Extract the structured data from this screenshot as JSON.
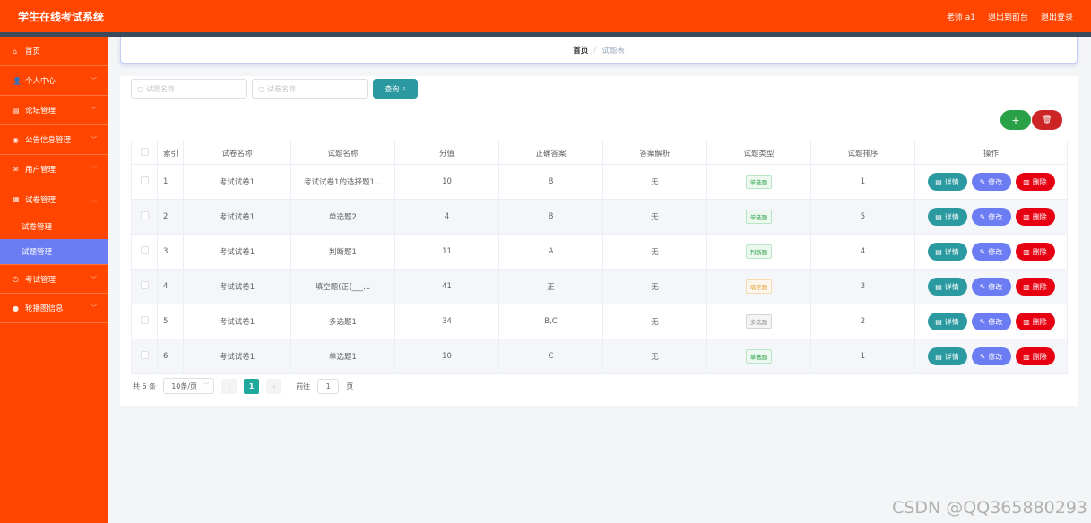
{
  "header": {
    "title": "学生在线考试系统",
    "links": [
      "老师 a1",
      "退出到前台",
      "退出登录"
    ]
  },
  "sidebar": {
    "items": [
      {
        "label": "首页",
        "icon": "home-icon"
      },
      {
        "label": "个人中心",
        "icon": "user-icon"
      },
      {
        "label": "论坛管理",
        "icon": "forum-icon"
      },
      {
        "label": "公告信息管理",
        "icon": "notice-icon"
      },
      {
        "label": "用户管理",
        "icon": "mail-icon"
      },
      {
        "label": "试卷管理",
        "icon": "paper-icon"
      },
      {
        "label": "考试管理",
        "icon": "exam-icon"
      },
      {
        "label": "轮播图信息",
        "icon": "carousel-icon"
      }
    ],
    "subitems": [
      "试卷管理",
      "试题管理"
    ]
  },
  "breadcrumb": {
    "home": "首页",
    "sep": "/",
    "current": "试题表"
  },
  "search": {
    "exam_name_placeholder": "试题名称",
    "paper_name_placeholder": "试卷名称",
    "button": "查询"
  },
  "toolbar": {
    "add_label": "+",
    "delete_label": "🗑"
  },
  "table": {
    "headers": [
      "索引",
      "试卷名称",
      "试题名称",
      "分值",
      "正确答案",
      "答案解析",
      "试题类型",
      "试题排序",
      "操作"
    ],
    "rows": [
      {
        "index": "1",
        "paper": "考试试卷1",
        "name": "考试试卷1的选择题1...",
        "score": "10",
        "answer": "B",
        "analysis": "无",
        "type": "单选题",
        "type_color": "green",
        "order": "1"
      },
      {
        "index": "2",
        "paper": "考试试卷1",
        "name": "单选题2",
        "score": "4",
        "answer": "B",
        "analysis": "无",
        "type": "单选题",
        "type_color": "green",
        "order": "5"
      },
      {
        "index": "3",
        "paper": "考试试卷1",
        "name": "判断题1",
        "score": "11",
        "answer": "A",
        "analysis": "无",
        "type": "判断题",
        "type_color": "green",
        "order": "4"
      },
      {
        "index": "4",
        "paper": "考试试卷1",
        "name": "填空题(正)___...",
        "score": "41",
        "answer": "正",
        "analysis": "无",
        "type": "填空题",
        "type_color": "orange",
        "order": "3"
      },
      {
        "index": "5",
        "paper": "考试试卷1",
        "name": "多选题1",
        "score": "34",
        "answer": "B,C",
        "analysis": "无",
        "type": "多选题",
        "type_color": "gray",
        "order": "2"
      },
      {
        "index": "6",
        "paper": "考试试卷1",
        "name": "单选题1",
        "score": "10",
        "answer": "C",
        "analysis": "无",
        "type": "单选题",
        "type_color": "green",
        "order": "1"
      }
    ],
    "ops": {
      "detail": "详情",
      "edit": "修改",
      "delete": "删除"
    }
  },
  "pager": {
    "total": "共 6 条",
    "page_size": "10条/页",
    "current_page": "1",
    "goto_label": "前往",
    "goto_value": "1",
    "page_suffix": "页"
  },
  "watermark": "CSDN @QQ365880293",
  "colors": {
    "brand": "#ff4500",
    "active_sub": "#6c7cf3",
    "teal": "#2b9aa0",
    "danger": "#e60012"
  }
}
